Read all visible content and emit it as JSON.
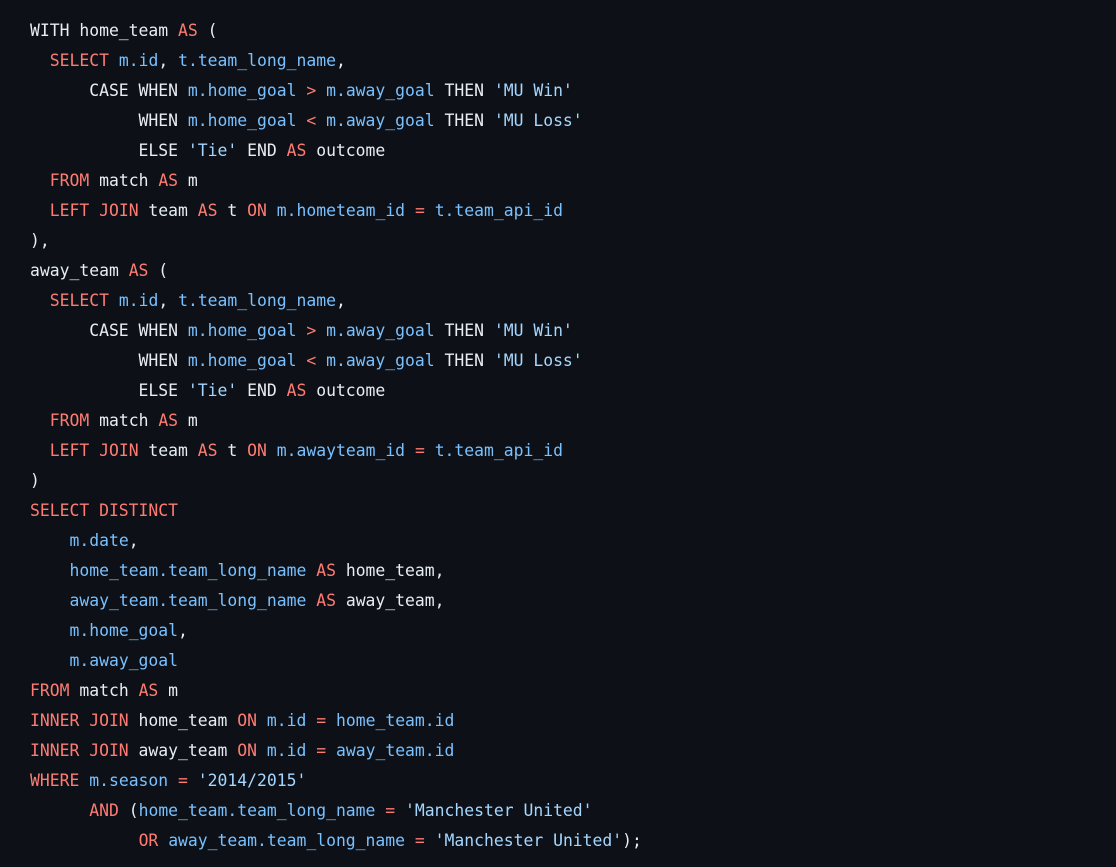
{
  "code_block": {
    "language": "sql",
    "lines": [
      [
        [
          "plain",
          "WITH home_team "
        ],
        [
          "kw",
          "AS"
        ],
        [
          "plain",
          " ("
        ]
      ],
      [
        [
          "plain",
          "  "
        ],
        [
          "kw",
          "SELECT"
        ],
        [
          "plain",
          " "
        ],
        [
          "id",
          "m.id"
        ],
        [
          "plain",
          ", "
        ],
        [
          "id",
          "t.team_long_name"
        ],
        [
          "plain",
          ","
        ]
      ],
      [
        [
          "plain",
          "      CASE WHEN "
        ],
        [
          "id",
          "m.home_goal"
        ],
        [
          "plain",
          " "
        ],
        [
          "op",
          ">"
        ],
        [
          "plain",
          " "
        ],
        [
          "id",
          "m.away_goal"
        ],
        [
          "plain",
          " THEN "
        ],
        [
          "str",
          "'MU Win'"
        ]
      ],
      [
        [
          "plain",
          "           WHEN "
        ],
        [
          "id",
          "m.home_goal"
        ],
        [
          "plain",
          " "
        ],
        [
          "op",
          "<"
        ],
        [
          "plain",
          " "
        ],
        [
          "id",
          "m.away_goal"
        ],
        [
          "plain",
          " THEN "
        ],
        [
          "str",
          "'MU Loss'"
        ]
      ],
      [
        [
          "plain",
          "           ELSE "
        ],
        [
          "str",
          "'Tie'"
        ],
        [
          "plain",
          " END "
        ],
        [
          "kw",
          "AS"
        ],
        [
          "plain",
          " outcome"
        ]
      ],
      [
        [
          "plain",
          "  "
        ],
        [
          "kw",
          "FROM"
        ],
        [
          "plain",
          " match "
        ],
        [
          "kw",
          "AS"
        ],
        [
          "plain",
          " m"
        ]
      ],
      [
        [
          "plain",
          "  "
        ],
        [
          "kw",
          "LEFT JOIN"
        ],
        [
          "plain",
          " team "
        ],
        [
          "kw",
          "AS"
        ],
        [
          "plain",
          " t "
        ],
        [
          "kw",
          "ON"
        ],
        [
          "plain",
          " "
        ],
        [
          "id",
          "m.hometeam_id"
        ],
        [
          "plain",
          " "
        ],
        [
          "op",
          "="
        ],
        [
          "plain",
          " "
        ],
        [
          "id",
          "t.team_api_id"
        ]
      ],
      [
        [
          "plain",
          "),"
        ]
      ],
      [
        [
          "plain",
          "away_team "
        ],
        [
          "kw",
          "AS"
        ],
        [
          "plain",
          " ("
        ]
      ],
      [
        [
          "plain",
          "  "
        ],
        [
          "kw",
          "SELECT"
        ],
        [
          "plain",
          " "
        ],
        [
          "id",
          "m.id"
        ],
        [
          "plain",
          ", "
        ],
        [
          "id",
          "t.team_long_name"
        ],
        [
          "plain",
          ","
        ]
      ],
      [
        [
          "plain",
          "      CASE WHEN "
        ],
        [
          "id",
          "m.home_goal"
        ],
        [
          "plain",
          " "
        ],
        [
          "op",
          ">"
        ],
        [
          "plain",
          " "
        ],
        [
          "id",
          "m.away_goal"
        ],
        [
          "plain",
          " THEN "
        ],
        [
          "str",
          "'MU Win'"
        ]
      ],
      [
        [
          "plain",
          "           WHEN "
        ],
        [
          "id",
          "m.home_goal"
        ],
        [
          "plain",
          " "
        ],
        [
          "op",
          "<"
        ],
        [
          "plain",
          " "
        ],
        [
          "id",
          "m.away_goal"
        ],
        [
          "plain",
          " THEN "
        ],
        [
          "str",
          "'MU Loss'"
        ]
      ],
      [
        [
          "plain",
          "           ELSE "
        ],
        [
          "str",
          "'Tie'"
        ],
        [
          "plain",
          " END "
        ],
        [
          "kw",
          "AS"
        ],
        [
          "plain",
          " outcome"
        ]
      ],
      [
        [
          "plain",
          "  "
        ],
        [
          "kw",
          "FROM"
        ],
        [
          "plain",
          " match "
        ],
        [
          "kw",
          "AS"
        ],
        [
          "plain",
          " m"
        ]
      ],
      [
        [
          "plain",
          "  "
        ],
        [
          "kw",
          "LEFT JOIN"
        ],
        [
          "plain",
          " team "
        ],
        [
          "kw",
          "AS"
        ],
        [
          "plain",
          " t "
        ],
        [
          "kw",
          "ON"
        ],
        [
          "plain",
          " "
        ],
        [
          "id",
          "m.awayteam_id"
        ],
        [
          "plain",
          " "
        ],
        [
          "op",
          "="
        ],
        [
          "plain",
          " "
        ],
        [
          "id",
          "t.team_api_id"
        ]
      ],
      [
        [
          "plain",
          ")"
        ]
      ],
      [
        [
          "kw",
          "SELECT DISTINCT"
        ]
      ],
      [
        [
          "plain",
          "    "
        ],
        [
          "id",
          "m.date"
        ],
        [
          "plain",
          ","
        ]
      ],
      [
        [
          "plain",
          "    "
        ],
        [
          "id",
          "home_team.team_long_name"
        ],
        [
          "plain",
          " "
        ],
        [
          "kw",
          "AS"
        ],
        [
          "plain",
          " home_team,"
        ]
      ],
      [
        [
          "plain",
          "    "
        ],
        [
          "id",
          "away_team.team_long_name"
        ],
        [
          "plain",
          " "
        ],
        [
          "kw",
          "AS"
        ],
        [
          "plain",
          " away_team,"
        ]
      ],
      [
        [
          "plain",
          "    "
        ],
        [
          "id",
          "m.home_goal"
        ],
        [
          "plain",
          ","
        ]
      ],
      [
        [
          "plain",
          "    "
        ],
        [
          "id",
          "m.away_goal"
        ]
      ],
      [
        [
          "kw",
          "FROM"
        ],
        [
          "plain",
          " match "
        ],
        [
          "kw",
          "AS"
        ],
        [
          "plain",
          " m"
        ]
      ],
      [
        [
          "kw",
          "INNER JOIN"
        ],
        [
          "plain",
          " home_team "
        ],
        [
          "kw",
          "ON"
        ],
        [
          "plain",
          " "
        ],
        [
          "id",
          "m.id"
        ],
        [
          "plain",
          " "
        ],
        [
          "op",
          "="
        ],
        [
          "plain",
          " "
        ],
        [
          "id",
          "home_team.id"
        ]
      ],
      [
        [
          "kw",
          "INNER JOIN"
        ],
        [
          "plain",
          " away_team "
        ],
        [
          "kw",
          "ON"
        ],
        [
          "plain",
          " "
        ],
        [
          "id",
          "m.id"
        ],
        [
          "plain",
          " "
        ],
        [
          "op",
          "="
        ],
        [
          "plain",
          " "
        ],
        [
          "id",
          "away_team.id"
        ]
      ],
      [
        [
          "kw",
          "WHERE"
        ],
        [
          "plain",
          " "
        ],
        [
          "id",
          "m.season"
        ],
        [
          "plain",
          " "
        ],
        [
          "op",
          "="
        ],
        [
          "plain",
          " "
        ],
        [
          "str",
          "'2014/2015'"
        ]
      ],
      [
        [
          "plain",
          "      "
        ],
        [
          "kw",
          "AND"
        ],
        [
          "plain",
          " ("
        ],
        [
          "id",
          "home_team.team_long_name"
        ],
        [
          "plain",
          " "
        ],
        [
          "op",
          "="
        ],
        [
          "plain",
          " "
        ],
        [
          "str",
          "'Manchester United'"
        ]
      ],
      [
        [
          "plain",
          "           "
        ],
        [
          "kw",
          "OR"
        ],
        [
          "plain",
          " "
        ],
        [
          "id",
          "away_team.team_long_name"
        ],
        [
          "plain",
          " "
        ],
        [
          "op",
          "="
        ],
        [
          "plain",
          " "
        ],
        [
          "str",
          "'Manchester United'"
        ],
        [
          "plain",
          ");"
        ]
      ]
    ]
  },
  "colors": {
    "background": "#0d1117",
    "keyword": "#ff7b72",
    "operator": "#ff7b72",
    "identifier": "#79c0ff",
    "string": "#a5d6ff",
    "plain": "#e6edf3"
  }
}
